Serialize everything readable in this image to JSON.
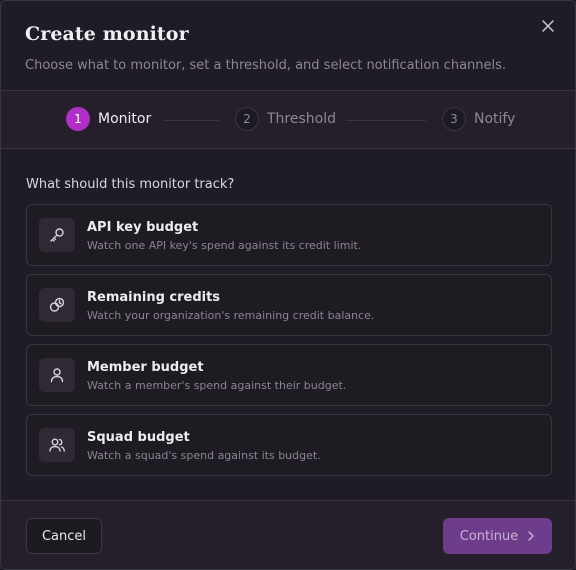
{
  "dialog": {
    "title": "Create monitor",
    "subtitle": "Choose what to monitor, set a threshold, and select notification channels.",
    "close_icon": "close-icon"
  },
  "stepper": {
    "steps": [
      {
        "number": "1",
        "label": "Monitor",
        "state": "active"
      },
      {
        "number": "2",
        "label": "Threshold",
        "state": "inactive"
      },
      {
        "number": "3",
        "label": "Notify",
        "state": "inactive"
      }
    ]
  },
  "question": "What should this monitor track?",
  "options": [
    {
      "title": "API key budget",
      "description": "Watch one API key's spend against its credit limit.",
      "icon": "key-icon"
    },
    {
      "title": "Remaining credits",
      "description": "Watch your organization's remaining credit balance.",
      "icon": "coins-clock-icon"
    },
    {
      "title": "Member budget",
      "description": "Watch a member's spend against their budget.",
      "icon": "user-icon"
    },
    {
      "title": "Squad budget",
      "description": "Watch a squad's spend against its budget.",
      "icon": "users-icon"
    }
  ],
  "footer": {
    "cancel_label": "Cancel",
    "continue_label": "Continue",
    "continue_icon": "chevron-right-icon"
  },
  "colors": {
    "accent": "#b02fc7",
    "continue_button": "#6d3d8c",
    "background": "#1f1c25"
  }
}
